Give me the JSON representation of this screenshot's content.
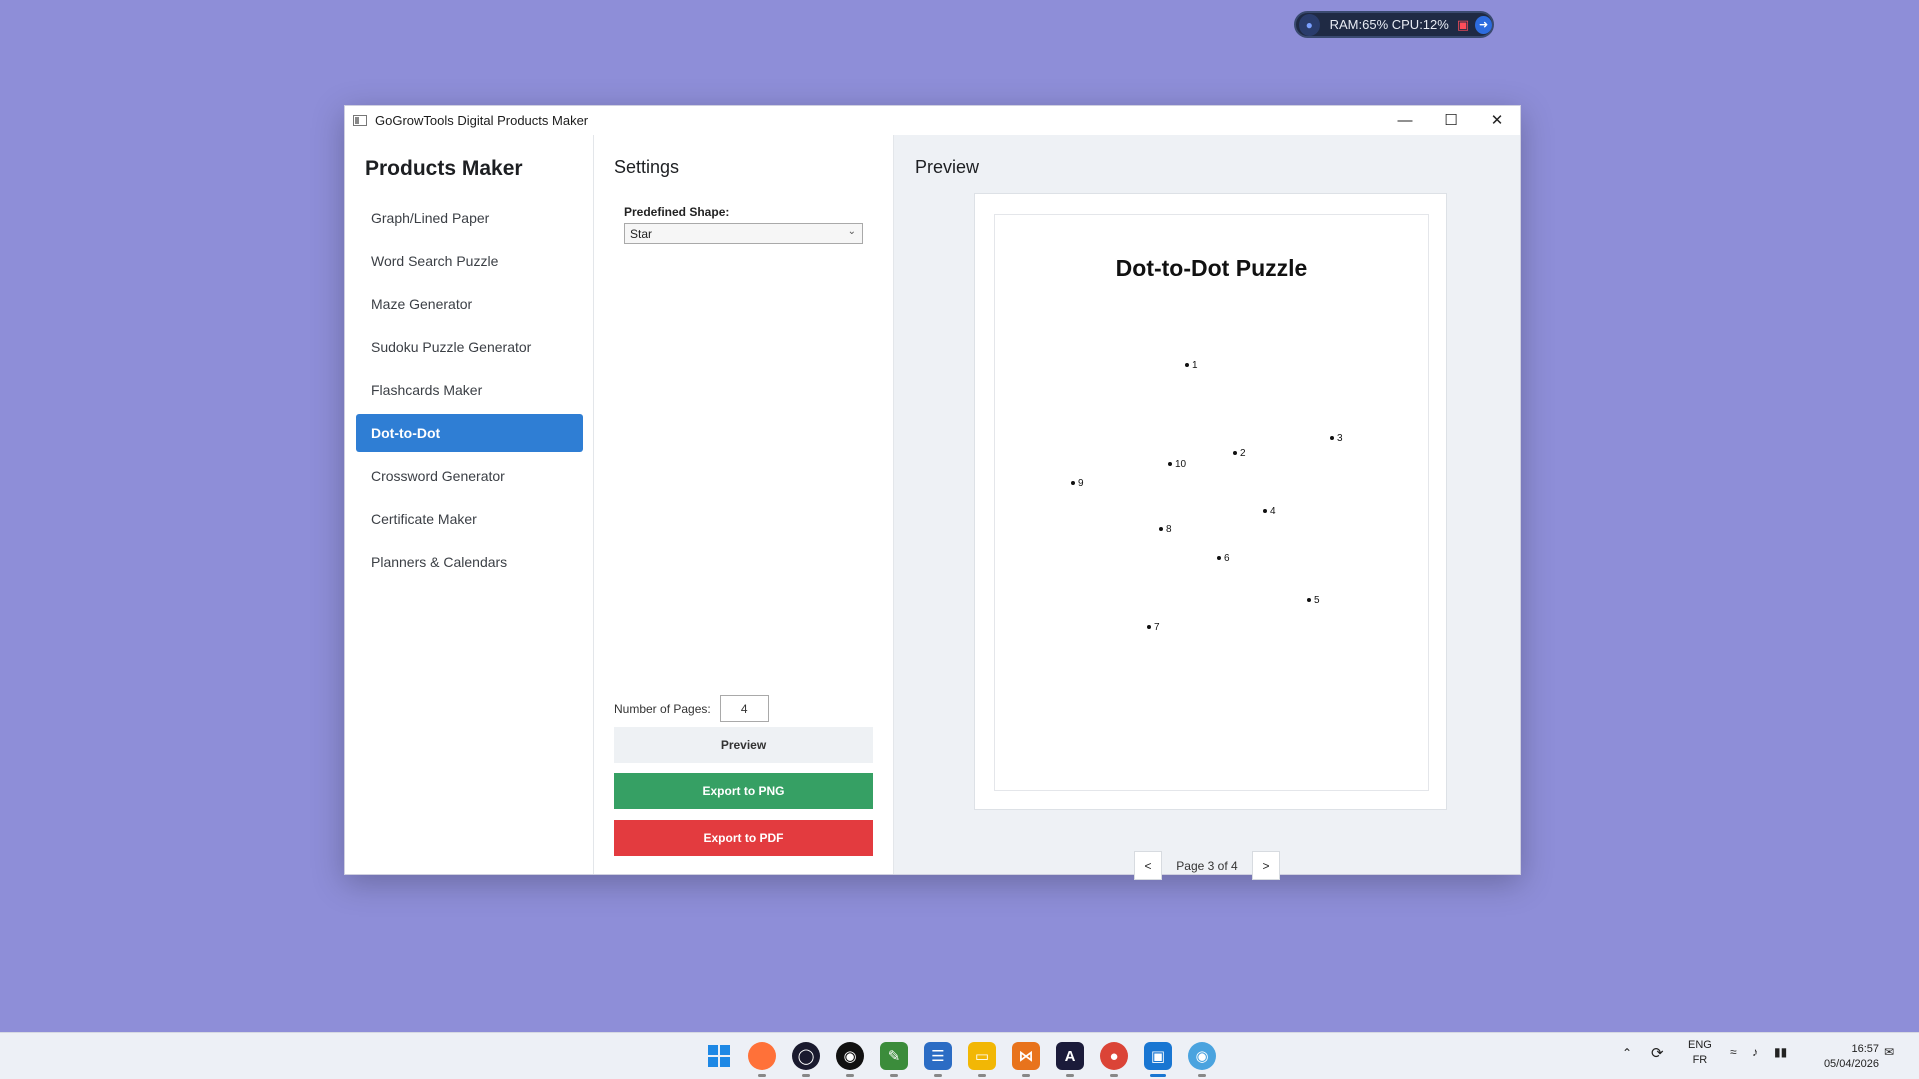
{
  "system_monitor": {
    "text": "RAM:65%  CPU:12%"
  },
  "window": {
    "title": "GoGrowTools Digital Products Maker"
  },
  "sidebar": {
    "heading": "Products Maker",
    "items": [
      {
        "label": "Graph/Lined Paper"
      },
      {
        "label": "Word Search Puzzle"
      },
      {
        "label": "Maze Generator"
      },
      {
        "label": "Sudoku Puzzle Generator"
      },
      {
        "label": "Flashcards Maker"
      },
      {
        "label": "Dot-to-Dot",
        "active": true
      },
      {
        "label": "Crossword Generator"
      },
      {
        "label": "Certificate Maker"
      },
      {
        "label": "Planners & Calendars"
      }
    ]
  },
  "settings": {
    "heading": "Settings",
    "shape_label": "Predefined Shape:",
    "shape_value": "Star",
    "pages_label": "Number of Pages:",
    "pages_value": "4",
    "preview_button": "Preview",
    "export_png_button": "Export to PNG",
    "export_pdf_button": "Export to PDF"
  },
  "preview": {
    "heading": "Preview",
    "puzzle_title": "Dot-to-Dot Puzzle",
    "dots": [
      {
        "n": "1"
      },
      {
        "n": "2"
      },
      {
        "n": "3"
      },
      {
        "n": "4"
      },
      {
        "n": "5"
      },
      {
        "n": "6"
      },
      {
        "n": "7"
      },
      {
        "n": "8"
      },
      {
        "n": "9"
      },
      {
        "n": "10"
      }
    ],
    "prev_button": "<",
    "page_info": "Page 3 of 4",
    "next_button": ">"
  },
  "taskbar": {
    "lang_top": "ENG",
    "lang_bottom": "FR",
    "time": "16:57",
    "date": "05/04/2026"
  },
  "colors": {
    "desktop": "#8e8ed8",
    "accent": "#2f7ed4",
    "export_png": "#36a064",
    "export_pdf": "#e33b3f"
  }
}
